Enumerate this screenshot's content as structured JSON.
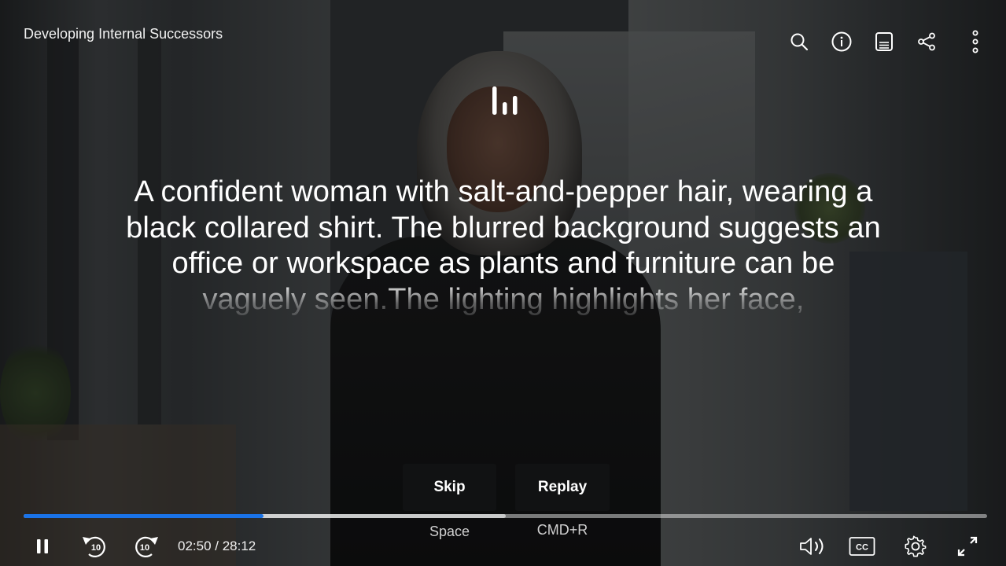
{
  "video": {
    "title": "Developing Internal Successors",
    "description": "A confident woman with salt-and-pepper hair, wearing a black collared shirt. The blurred background suggests an office or workspace as plants and furniture can be vaguely seen.The lighting highlights her face,"
  },
  "top_bar": {
    "icons": [
      "search-icon",
      "info-icon",
      "transcript-icon",
      "share-icon",
      "more-vertical-icon"
    ]
  },
  "overlay": {
    "skip_label": "Skip",
    "skip_hint": "Space",
    "replay_label": "Replay",
    "replay_hint": "CMD+R"
  },
  "playback": {
    "current_time": "02:50",
    "duration": "28:12",
    "time_display": "02:50 / 28:12",
    "played_fraction": 0.249,
    "buffered_fraction": 0.5
  },
  "controls": {
    "left": [
      "pause-icon",
      "rewind-10-icon",
      "forward-10-icon"
    ],
    "right": [
      "volume-icon",
      "closed-captions-icon",
      "settings-icon",
      "fullscreen-icon"
    ],
    "rewind_seconds": "10",
    "forward_seconds": "10",
    "cc_label": "CC"
  },
  "colors": {
    "progress_played": "#1a73e8",
    "button_bg": "#111213"
  }
}
